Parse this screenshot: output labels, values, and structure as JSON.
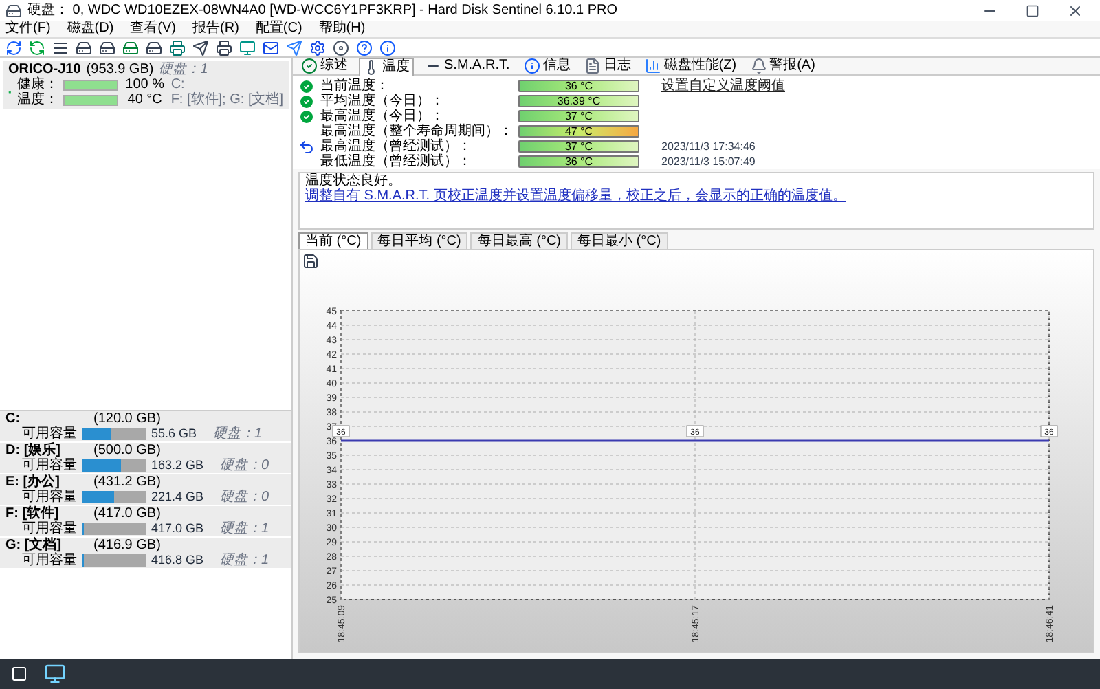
{
  "window": {
    "title": "硬盘： 0, WDC WD10EZEX-08WN4A0 [WD-WCC6Y1PF3KRP]  -  Hard Disk Sentinel 6.10.1 PRO"
  },
  "menu": [
    "文件(F)",
    "磁盘(D)",
    "查看(V)",
    "报告(R)",
    "配置(C)",
    "帮助(H)"
  ],
  "disk": {
    "name": "ORICO-J10",
    "size": "(953.9 GB)",
    "disk_no": "硬盘：1",
    "health_label": "健康：",
    "health_value": "100 %",
    "health_extra": "C:",
    "temp_label": "温度：",
    "temp_value": "40 °C",
    "temp_extra": "F: [软件]; G: [文档]"
  },
  "volumes": [
    {
      "name": "C:",
      "size": "(120.0 GB)",
      "free_label": "可用容量",
      "free": "55.6 GB",
      "level": 0.45,
      "disk_no": "硬盘：1"
    },
    {
      "name": "D: [娱乐]",
      "size": "(500.0 GB)",
      "free_label": "可用容量",
      "free": "163.2 GB",
      "level": 0.6,
      "disk_no": "硬盘：0"
    },
    {
      "name": "E: [办公]",
      "size": "(431.2 GB)",
      "free_label": "可用容量",
      "free": "221.4 GB",
      "level": 0.5,
      "disk_no": "硬盘：0"
    },
    {
      "name": "F: [软件]",
      "size": "(417.0 GB)",
      "free_label": "可用容量",
      "free": "417.0 GB",
      "level": 0,
      "disk_no": "硬盘：1"
    },
    {
      "name": "G: [文档]",
      "size": "(416.9 GB)",
      "free_label": "可用容量",
      "free": "416.8 GB",
      "level": 0,
      "disk_no": "硬盘：1"
    }
  ],
  "tabs": [
    {
      "label": "综述",
      "selected": false
    },
    {
      "label": "温度",
      "selected": true
    },
    {
      "label": "S.M.A.R.T.",
      "selected": false
    },
    {
      "label": "信息",
      "selected": false
    },
    {
      "label": "日志",
      "selected": false
    },
    {
      "label": "磁盘性能(Z)",
      "selected": false
    },
    {
      "label": "警报(A)",
      "selected": false
    }
  ],
  "temperatures": [
    {
      "kind": "ok",
      "label": "当前温度：",
      "value": "36 °C",
      "warning": false,
      "link": "设置自定义温度阈值"
    },
    {
      "kind": "ok",
      "label": "平均温度（今日）：",
      "value": "36.39 °C",
      "warning": false
    },
    {
      "kind": "ok",
      "label": "最高温度（今日）：",
      "value": "37 °C",
      "warning": false
    },
    {
      "kind": "none",
      "label": "最高温度（整个寿命周期间）：",
      "value": "47 °C",
      "warning": true
    },
    {
      "kind": "reset",
      "label": "最高温度（曾经测试）：",
      "value": "37 °C",
      "warning": false,
      "note": "2023/11/3 17:34:46"
    },
    {
      "kind": "none",
      "label": "最低温度（曾经测试）：",
      "value": "36 °C",
      "warning": false,
      "note": "2023/11/3 15:07:49"
    }
  ],
  "description": {
    "status": "温度状态良好。",
    "link": "调整自有 S.M.A.R.T. 页校正温度并设置温度偏移量，校正之后，会显示的正确的温度值。"
  },
  "chart_tabs": [
    {
      "label": "当前 (°C)",
      "selected": true
    },
    {
      "label": "每日平均 (°C)",
      "selected": false
    },
    {
      "label": "每日最高 (°C)",
      "selected": false
    },
    {
      "label": "每日最小 (°C)",
      "selected": false
    }
  ],
  "chart_data": {
    "type": "line",
    "categories": [
      "18:45:09",
      "18:45:17",
      "18:46:41"
    ],
    "series": [
      {
        "color": "#3b3bb0",
        "values": [
          36,
          36,
          36
        ]
      }
    ],
    "ylim": [
      25,
      45
    ],
    "yticks": [
      25,
      26,
      27,
      28,
      29,
      30,
      31,
      32,
      33,
      34,
      35,
      36,
      37,
      38,
      39,
      40,
      41,
      42,
      43,
      44,
      45
    ],
    "grid": true,
    "data_labels": true
  }
}
